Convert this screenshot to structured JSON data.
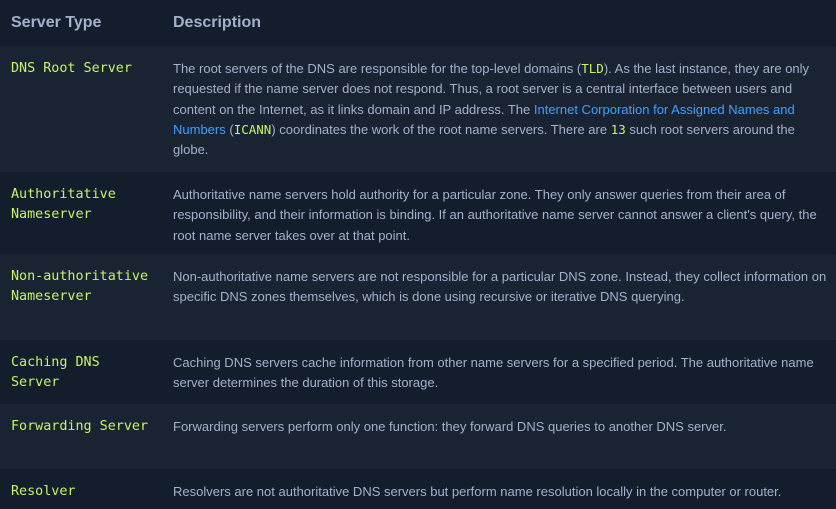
{
  "table": {
    "headers": {
      "type": "Server Type",
      "description": "Description"
    },
    "rows": [
      {
        "type": "DNS Root Server",
        "desc": {
          "p1": "The root servers of the DNS are responsible for the top-level domains (",
          "code1": "TLD",
          "p2": "). As the last instance, they are only requested if the name server does not respond. Thus, a root server is a central interface between users and content on the Internet, as it links domain and IP address. The ",
          "link": "Internet Corporation for Assigned Names and Numbers",
          "p3": " (",
          "code2": "ICANN",
          "p4": ") coordinates the work of the root name servers. There are ",
          "code3": "13",
          "p5": " such root servers around the globe."
        }
      },
      {
        "type": "Authoritative Nameserver",
        "desc": "Authoritative name servers hold authority for a particular zone. They only answer queries from their area of responsibility, and their information is binding. If an authoritative name server cannot answer a client's query, the root name server takes over at that point."
      },
      {
        "type": "Non-authoritative Nameserver",
        "desc": "Non-authoritative name servers are not responsible for a particular DNS zone. Instead, they collect information on specific DNS zones themselves, which is done using recursive or iterative DNS querying."
      },
      {
        "type": "Caching DNS Server",
        "desc": "Caching DNS servers cache information from other name servers for a specified period. The authoritative name server determines the duration of this storage."
      },
      {
        "type": "Forwarding Server",
        "desc": "Forwarding servers perform only one function: they forward DNS queries to another DNS server."
      },
      {
        "type": "Resolver",
        "desc": "Resolvers are not authoritative DNS servers but perform name resolution locally in the computer or router."
      }
    ]
  }
}
